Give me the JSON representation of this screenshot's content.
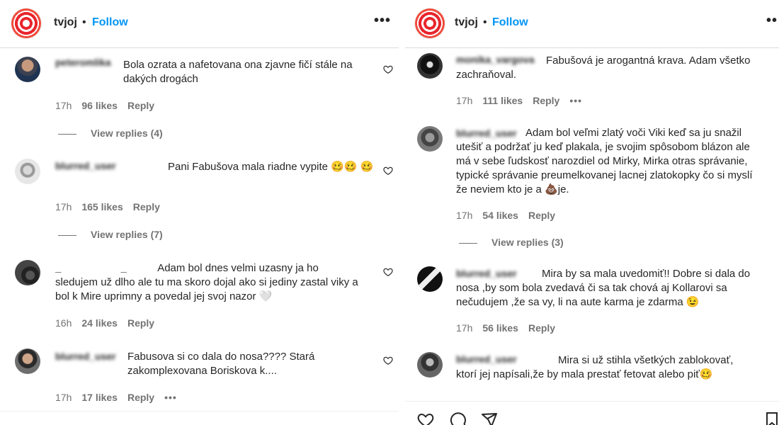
{
  "left": {
    "header": {
      "handle": "tvjoj",
      "separator": "•",
      "follow": "Follow",
      "more": "•••"
    },
    "comments": [
      {
        "user": "peteromlika",
        "text": "Bola ozrata a nafetovana ona zjavne fičí stále na dakých drogách",
        "time": "17h",
        "likes": "96 likes",
        "reply": "Reply",
        "view_replies": "View replies (4)"
      },
      {
        "user": "blurred_user",
        "text": "Pani Fabušova mala riadne vypite 🥴🥴 🥴",
        "time": "17h",
        "likes": "165 likes",
        "reply": "Reply",
        "view_replies": "View replies (7)"
      },
      {
        "user": "_ _",
        "text": "Adam bol dnes velmi uzasny ja ho sledujem už dlho ale tu ma skoro dojal ako si jediny zastal viky a bol k Mire uprimny a povedal jej svoj nazor 🤍",
        "time": "16h",
        "likes": "24 likes",
        "reply": "Reply"
      },
      {
        "user": "blurred_user",
        "text": "Fabusova si co dala do nosa???? Stará zakomplexovana Boriskova k....",
        "time": "17h",
        "likes": "17 likes",
        "reply": "Reply",
        "more": "•••"
      }
    ]
  },
  "right": {
    "header": {
      "handle": "tvjoj",
      "separator": "•",
      "follow": "Follow",
      "more": "••"
    },
    "comments": [
      {
        "user": "monika_vargova",
        "text_line1": "Fabušová je arogantná krava. Adam všetko",
        "text_line2": "zachraňoval.",
        "time": "17h",
        "likes": "111 likes",
        "reply": "Reply",
        "more": "•••"
      },
      {
        "user": "blurred_user",
        "text": "Adam bol veľmi zlatý voči Viki keď sa ju snažil utešiť a podržať ju keď plakala, je svojim spôsobom blázon ale má v sebe ľudskosť narozdiel od Mirky, Mirka otras správanie, typické správanie preumelkovanej lacnej zlatokopky čo si myslí že neviem kto je a 💩je.",
        "time": "17h",
        "likes": "54 likes",
        "reply": "Reply",
        "view_replies": "View replies (3)"
      },
      {
        "user": "blurred_user",
        "text": "Mira by sa mala uvedomiť!! Dobre si dala do nosa ,by som bola zvedavá či sa tak chová aj Kollarovi sa nečudujem ,že sa vy, li na aute karma je zdarma 😉",
        "time": "17h",
        "likes": "56 likes",
        "reply": "Reply"
      },
      {
        "user": "blurred_user",
        "text": "Mira si už stihla všetkých zablokovať, ktorí jej napísali,že by mala prestať fetovat alebo piť🥴",
        "time": "",
        "likes": "",
        "reply": ""
      }
    ]
  },
  "icons": [
    "heart-icon",
    "comment-icon",
    "share-icon",
    "bookmark-icon",
    "more-icon"
  ]
}
